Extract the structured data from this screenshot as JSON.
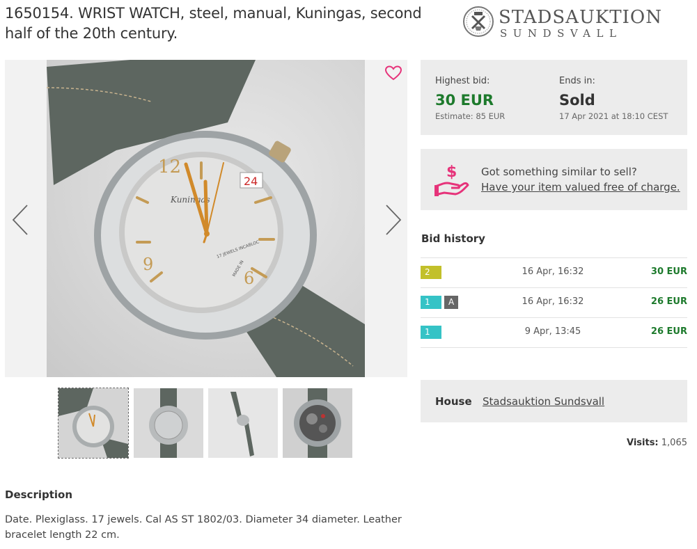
{
  "lot": {
    "title": "1650154. WRIST WATCH, steel, manual, Kuningas, second half of the 20th century."
  },
  "logo": {
    "line1": "STADSAUKTION",
    "line2": "SUNDSVALL"
  },
  "gallery": {
    "photo": {
      "dial_brand": "Kuningas",
      "dial_text": "17 JEWELS INCABLOC",
      "dial_made": "MADE IN",
      "dial_date": "24",
      "dial_numerals": [
        "12",
        "9",
        "6"
      ]
    },
    "thumbnails": [
      "front",
      "back",
      "side",
      "movement"
    ],
    "active_thumbnail": 0
  },
  "bid": {
    "highest_label": "Highest bid:",
    "highest_value": "30 EUR",
    "estimate": "Estimate: 85 EUR",
    "ends_label": "Ends in:",
    "ends_value": "Sold",
    "ends_date": "17 Apr 2021 at 18:10 CEST"
  },
  "sell": {
    "question": "Got something similar to sell?",
    "link": "Have your item valued free of charge."
  },
  "bid_history": {
    "title": "Bid history",
    "rows": [
      {
        "bidder": "2",
        "tag": "",
        "date": "16 Apr, 16:32",
        "amount": "30 EUR",
        "color": "#c2c02a"
      },
      {
        "bidder": "1",
        "tag": "A",
        "date": "16 Apr, 16:32",
        "amount": "26 EUR",
        "color": "#35c3c6"
      },
      {
        "bidder": "1",
        "tag": "",
        "date": "9 Apr, 13:45",
        "amount": "26 EUR",
        "color": "#35c3c6"
      }
    ]
  },
  "house": {
    "label": "House",
    "name": "Stadsauktion Sundsvall"
  },
  "visits": {
    "label": "Visits:",
    "count": "1,065"
  },
  "description": {
    "title": "Description",
    "text": "Date. Plexiglass. 17 jewels. Cal AS ST 1802/03. Diameter 34 diameter. Leather bracelet length 22 cm."
  },
  "colors": {
    "accent_pink": "#e6337a",
    "price_green": "#1d7a2c",
    "panel_bg": "#ececec",
    "tag_gray": "#666666"
  }
}
